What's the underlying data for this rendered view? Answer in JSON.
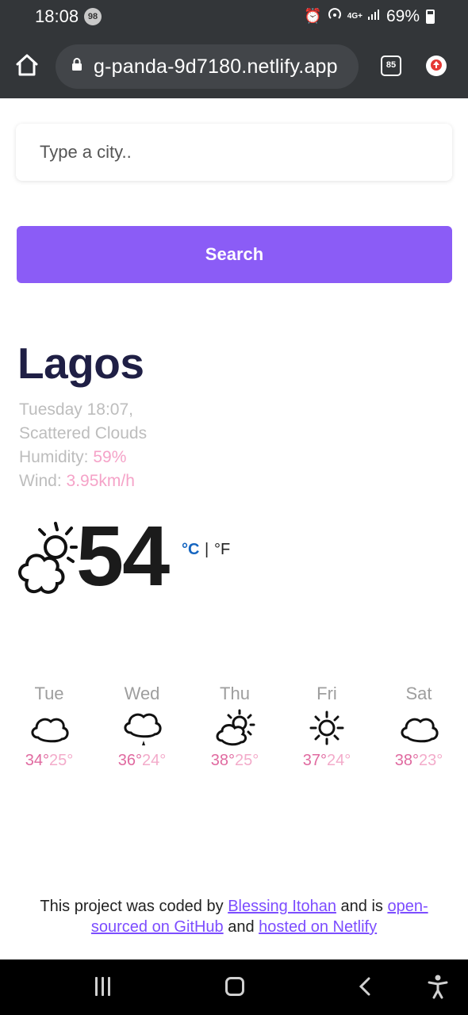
{
  "status_bar": {
    "time": "18:08",
    "notification_count": "98",
    "network": "4G+",
    "battery": "69%"
  },
  "browser": {
    "url": "g-panda-9d7180.netlify.app",
    "tab_count": "85"
  },
  "search": {
    "placeholder": "Type a city..",
    "button_label": "Search"
  },
  "weather": {
    "city": "Lagos",
    "datetime": "Tuesday 18:07,",
    "description": "Scattered Clouds",
    "humidity_label": "Humidity:",
    "humidity_value": "59%",
    "wind_label": "Wind:",
    "wind_value": "3.95km/h",
    "temperature": "54",
    "icon": "scattered-clouds-icon",
    "unit_celsius": "°C",
    "unit_separator": "|",
    "unit_fahrenheit": "°F"
  },
  "forecast": [
    {
      "day": "Tue",
      "high": "34°",
      "low": "25°",
      "icon": "cloud-icon"
    },
    {
      "day": "Wed",
      "high": "36°",
      "low": "24°",
      "icon": "rain-cloud-icon"
    },
    {
      "day": "Thu",
      "high": "38°",
      "low": "25°",
      "icon": "partly-cloudy-icon"
    },
    {
      "day": "Fri",
      "high": "37°",
      "low": "24°",
      "icon": "sun-icon"
    },
    {
      "day": "Sat",
      "high": "38°",
      "low": "23°",
      "icon": "cloud-icon"
    }
  ],
  "footer": {
    "text_1": "This project was coded by",
    "author_link": "Blessing Itohan",
    "text_2": "and is",
    "github_link_a": "open-",
    "github_link_b": "sourced on GitHub",
    "text_3": "and",
    "netlify_link": "hosted on Netlify"
  },
  "colors": {
    "accent": "#8b5cf6",
    "city": "#1f1f45",
    "pink": "#f5a3c8",
    "celsius": "#1565c0",
    "browser_bar": "#333639"
  }
}
